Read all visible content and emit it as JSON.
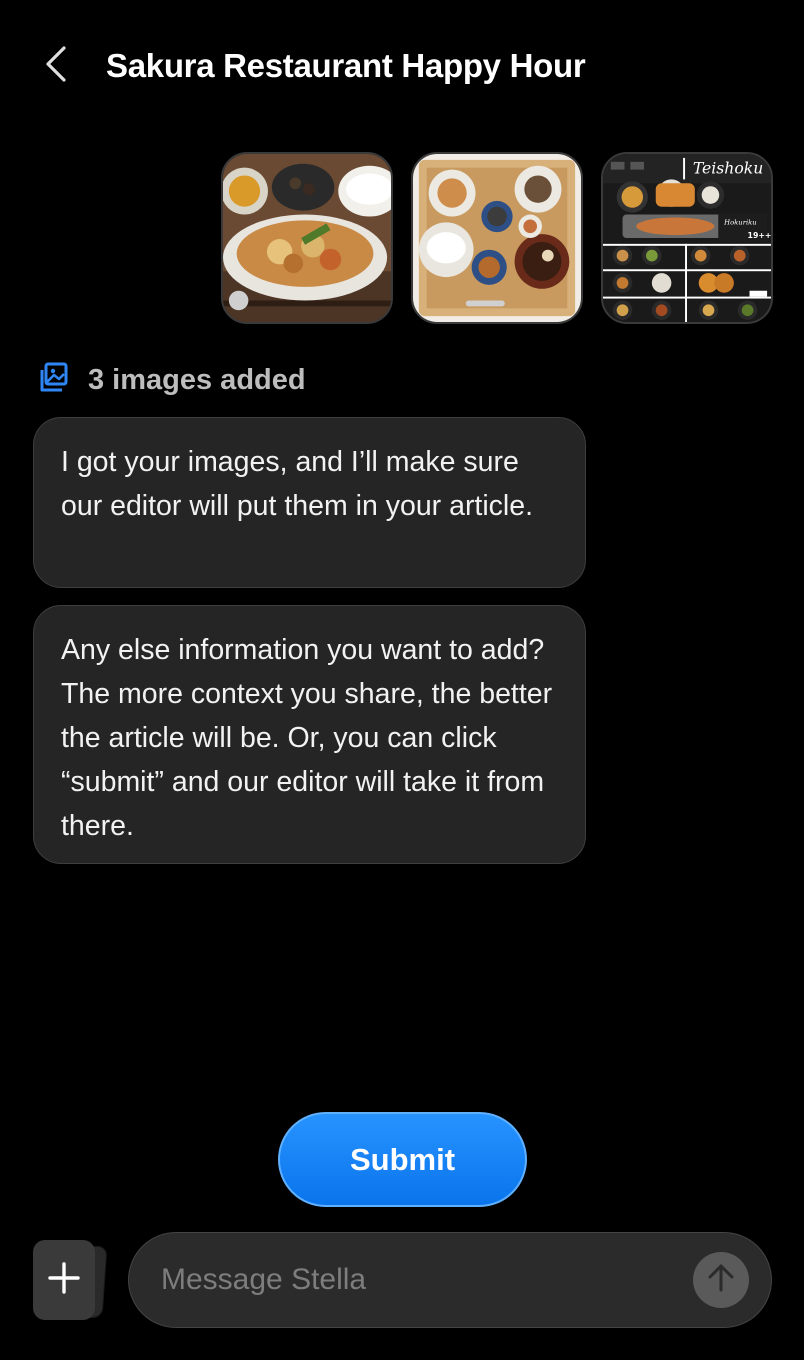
{
  "header": {
    "title": "Sakura Restaurant Happy Hour",
    "back_icon": "chevron-left-icon"
  },
  "thumbnails": [
    {
      "name": "thumbnail-food-1"
    },
    {
      "name": "thumbnail-food-2"
    },
    {
      "name": "thumbnail-teishoku-menu",
      "menu_header": "Teishoku"
    }
  ],
  "images_added": {
    "icon": "image-gallery-icon",
    "label": "3 images added",
    "icon_color": "#2f86f6"
  },
  "messages": [
    {
      "text": "I got your images, and I’ll make sure our editor will put them in your article."
    },
    {
      "text": "Any else information you want to add? The more context you share, the better the article will be. Or, you can click “submit” and our editor will take it from there."
    }
  ],
  "submit": {
    "label": "Submit",
    "color": "#0a7cf0"
  },
  "composer": {
    "placeholder": "Message Stella",
    "plus_icon": "plus-icon",
    "send_icon": "arrow-up-icon"
  }
}
